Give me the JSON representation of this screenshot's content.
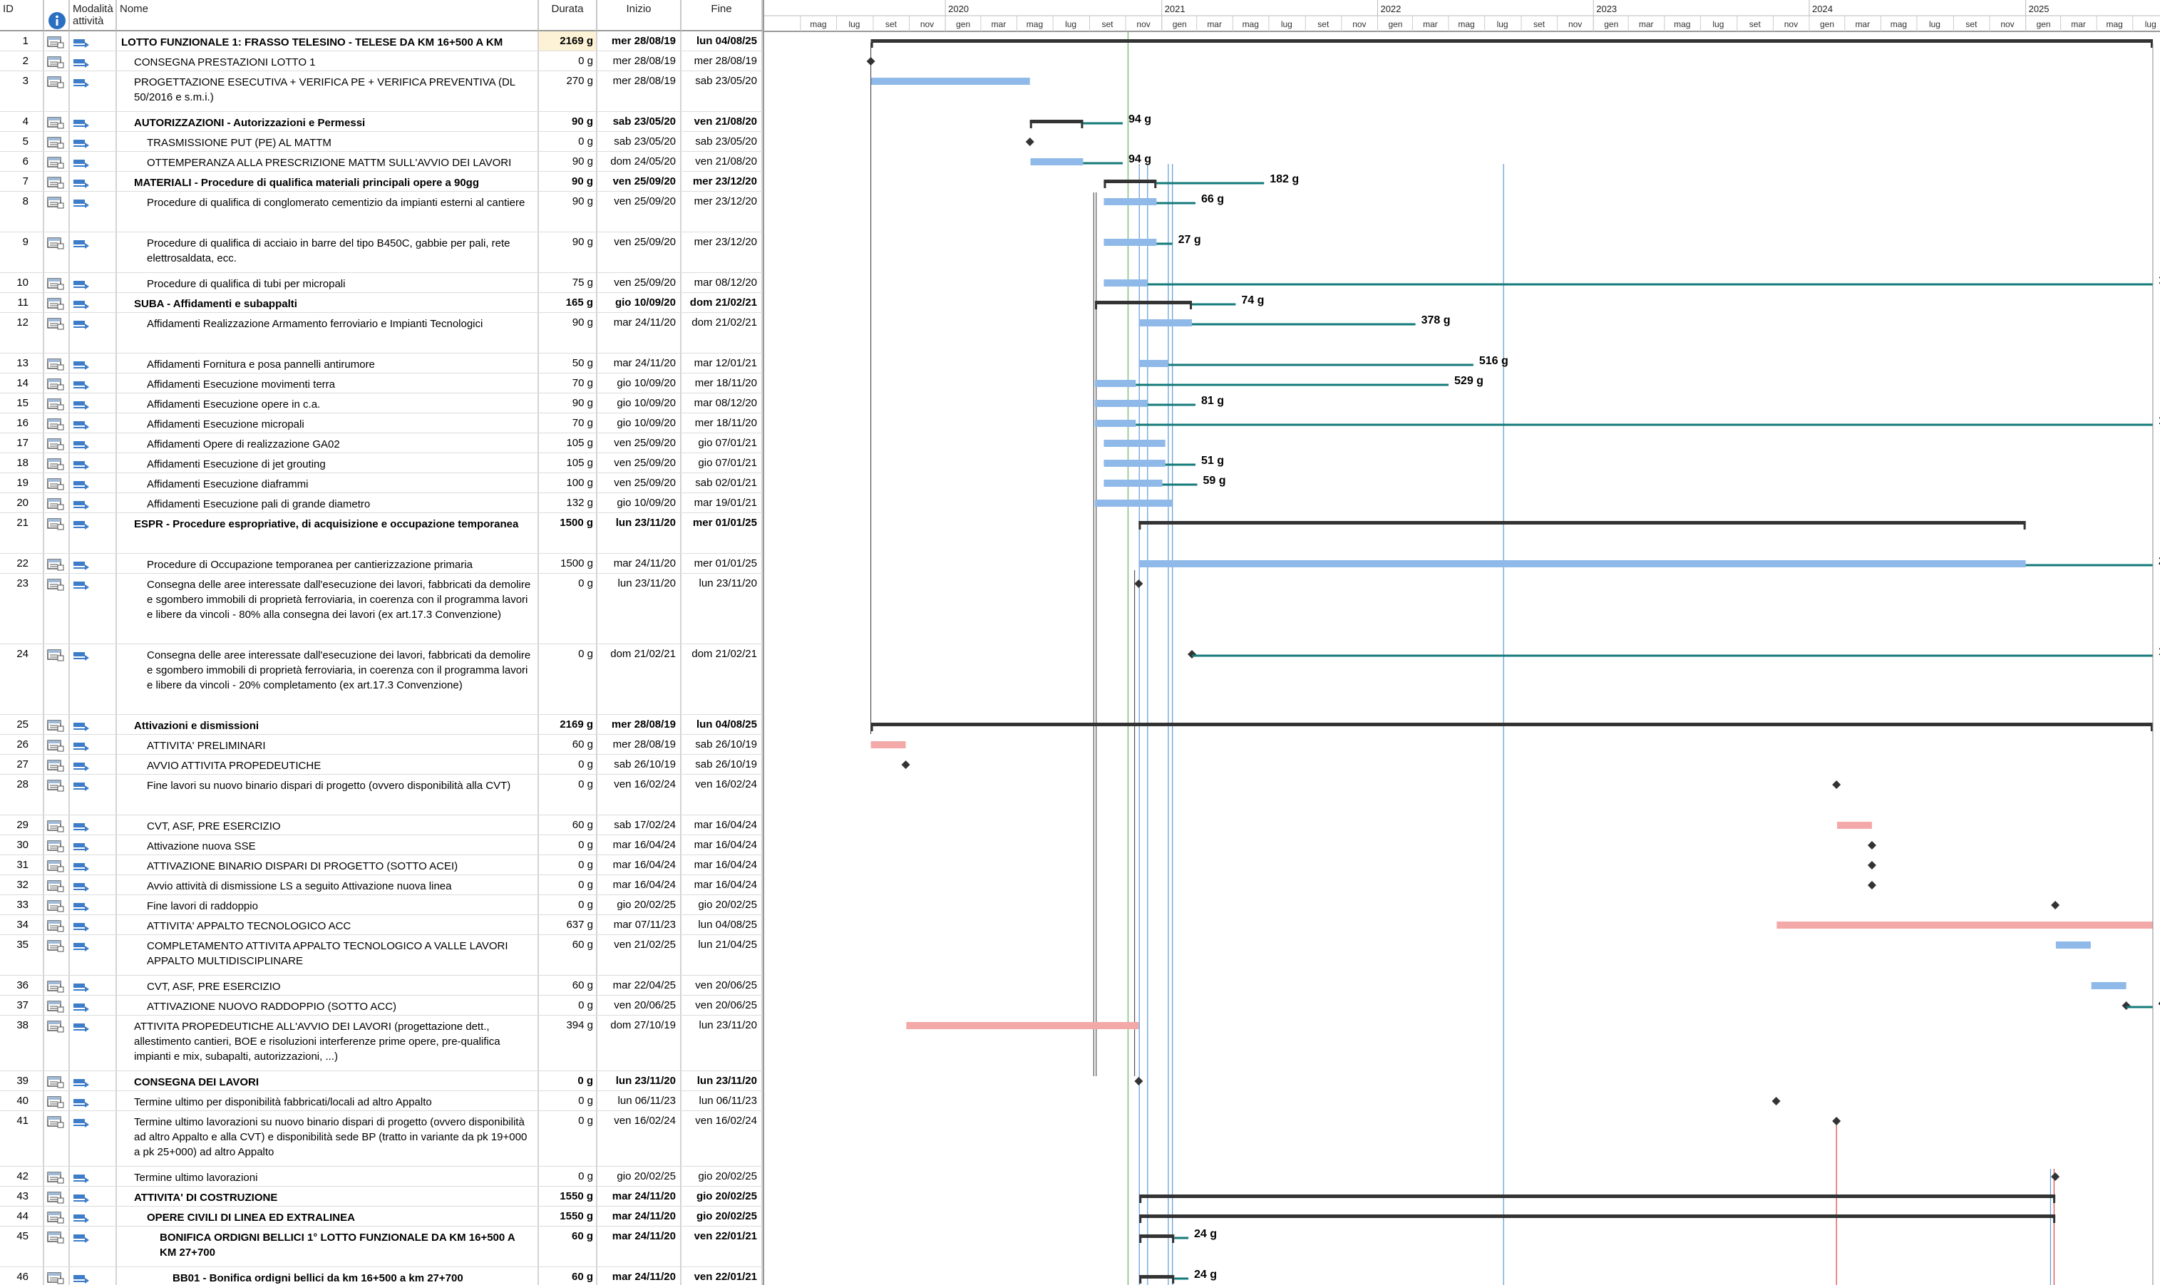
{
  "headers": {
    "id": "ID",
    "info_icon": "info-icon",
    "mode": "Modalità attività",
    "name": "Nome",
    "duration": "Durata",
    "start": "Inizio",
    "finish": "Fine"
  },
  "timescale": {
    "years": [
      {
        "label": "2020",
        "start": "2020-01-01"
      },
      {
        "label": "2021",
        "start": "2021-01-01"
      },
      {
        "label": "2022",
        "start": "2022-01-01"
      },
      {
        "label": "2023",
        "start": "2023-01-01"
      },
      {
        "label": "2024",
        "start": "2024-01-01"
      },
      {
        "label": "2025",
        "start": "2025-01-01"
      }
    ],
    "months": [
      {
        "label": "mag",
        "start": "2019-05-01"
      },
      {
        "label": "lug",
        "start": "2019-07-01"
      },
      {
        "label": "set",
        "start": "2019-09-01"
      },
      {
        "label": "nov",
        "start": "2019-11-01"
      },
      {
        "label": "gen",
        "start": "2020-01-01"
      },
      {
        "label": "mar",
        "start": "2020-03-01"
      },
      {
        "label": "mag",
        "start": "2020-05-01"
      },
      {
        "label": "lug",
        "start": "2020-07-01"
      },
      {
        "label": "set",
        "start": "2020-09-01"
      },
      {
        "label": "nov",
        "start": "2020-11-01"
      },
      {
        "label": "gen",
        "start": "2021-01-01"
      },
      {
        "label": "mar",
        "start": "2021-03-01"
      },
      {
        "label": "mag",
        "start": "2021-05-01"
      },
      {
        "label": "lug",
        "start": "2021-07-01"
      },
      {
        "label": "set",
        "start": "2021-09-01"
      },
      {
        "label": "nov",
        "start": "2021-11-01"
      },
      {
        "label": "gen",
        "start": "2022-01-01"
      },
      {
        "label": "mar",
        "start": "2022-03-01"
      },
      {
        "label": "mag",
        "start": "2022-05-01"
      },
      {
        "label": "lug",
        "start": "2022-07-01"
      },
      {
        "label": "set",
        "start": "2022-09-01"
      },
      {
        "label": "nov",
        "start": "2022-11-01"
      },
      {
        "label": "gen",
        "start": "2023-01-01"
      },
      {
        "label": "mar",
        "start": "2023-03-01"
      },
      {
        "label": "mag",
        "start": "2023-05-01"
      },
      {
        "label": "lug",
        "start": "2023-07-01"
      },
      {
        "label": "set",
        "start": "2023-09-01"
      },
      {
        "label": "nov",
        "start": "2023-11-01"
      },
      {
        "label": "gen",
        "start": "2024-01-01"
      },
      {
        "label": "mar",
        "start": "2024-03-01"
      },
      {
        "label": "mag",
        "start": "2024-05-01"
      },
      {
        "label": "lug",
        "start": "2024-07-01"
      },
      {
        "label": "set",
        "start": "2024-09-01"
      },
      {
        "label": "nov",
        "start": "2024-11-01"
      },
      {
        "label": "gen",
        "start": "2025-01-01"
      },
      {
        "label": "mar",
        "start": "2025-03-01"
      },
      {
        "label": "mag",
        "start": "2025-05-01"
      },
      {
        "label": "lug",
        "start": "2025-07-01"
      },
      {
        "label": "set",
        "start": "2025-09-01"
      }
    ]
  },
  "colors": {
    "task_bar": "#8fb9e8",
    "critical_bar": "#f4a9a9",
    "summary_bar": "#333333",
    "slack_line": "#137a7a",
    "link_line": "#555555",
    "link_blue": "#5b9bd5",
    "link_red": "#e0403c",
    "status_date_line": "#7fbf7f"
  },
  "tasks": [
    {
      "id": "1",
      "name": "LOTTO FUNZIONALE 1: FRASSO TELESINO - TELESE DA KM 16+500 A KM 27+700",
      "duration": "2169 g",
      "start": "mer 28/08/19",
      "finish": "lun 04/08/25",
      "bold": true,
      "indent": 0,
      "lines": 1,
      "type": "summary",
      "s": "2019-08-28",
      "f": "2025-08-04",
      "selected": true
    },
    {
      "id": "2",
      "name": "CONSEGNA PRESTAZIONI LOTTO 1",
      "duration": "0 g",
      "start": "mer 28/08/19",
      "finish": "mer 28/08/19",
      "indent": 1,
      "lines": 1,
      "type": "milestone",
      "s": "2019-08-28",
      "f": "2019-08-28"
    },
    {
      "id": "3",
      "name": "PROGETTAZIONE ESECUTIVA + VERIFICA PE + VERIFICA PREVENTIVA (DL 50/2016 e s.m.i.)",
      "duration": "270 g",
      "start": "mer 28/08/19",
      "finish": "sab 23/05/20",
      "indent": 1,
      "lines": 2,
      "type": "task",
      "s": "2019-08-28",
      "f": "2020-05-23"
    },
    {
      "id": "4",
      "name": "AUTORIZZAZIONI - Autorizzazioni e Permessi",
      "duration": "90 g",
      "start": "sab 23/05/20",
      "finish": "ven 21/08/20",
      "bold": true,
      "indent": 1,
      "lines": 1,
      "type": "summary",
      "s": "2020-05-23",
      "f": "2020-08-21",
      "slack_to": "2020-10-27",
      "slack_label": "94 g"
    },
    {
      "id": "5",
      "name": "TRASMISSIONE PUT (PE) AL MATTM",
      "duration": "0 g",
      "start": "sab 23/05/20",
      "finish": "sab 23/05/20",
      "indent": 2,
      "lines": 1,
      "type": "milestone",
      "s": "2020-05-23",
      "f": "2020-05-23"
    },
    {
      "id": "6",
      "name": "OTTEMPERANZA ALLA PRESCRIZIONE MATTM SULL'AVVIO DEI LAVORI",
      "duration": "90 g",
      "start": "dom 24/05/20",
      "finish": "ven 21/08/20",
      "indent": 2,
      "lines": 1,
      "type": "task",
      "s": "2020-05-24",
      "f": "2020-08-21",
      "slack_to": "2020-10-27",
      "slack_label": "94 g"
    },
    {
      "id": "7",
      "name": "MATERIALI - Procedure di qualifica materiali principali opere a 90gg",
      "duration": "90 g",
      "start": "ven 25/09/20",
      "finish": "mer 23/12/20",
      "bold": true,
      "indent": 1,
      "lines": 1,
      "type": "summary",
      "s": "2020-09-25",
      "f": "2020-12-23",
      "slack_to": "2021-06-23",
      "slack_label": "182 g"
    },
    {
      "id": "8",
      "name": "Procedure di qualifica di conglomerato cementizio da impianti esterni al cantiere",
      "duration": "90 g",
      "start": "ven 25/09/20",
      "finish": "mer 23/12/20",
      "indent": 2,
      "lines": 2,
      "type": "task",
      "s": "2020-09-25",
      "f": "2020-12-23",
      "slack_to": "2021-02-27",
      "slack_label": "66 g"
    },
    {
      "id": "9",
      "name": "Procedure di qualifica di acciaio in barre del tipo B450C, gabbie per pali, rete elettrosaldata, ecc.",
      "duration": "90 g",
      "start": "ven 25/09/20",
      "finish": "mer 23/12/20",
      "indent": 2,
      "lines": 2,
      "type": "task",
      "s": "2020-09-25",
      "f": "2020-12-23",
      "slack_to": "2021-01-19",
      "slack_label": "27 g"
    },
    {
      "id": "10",
      "name": "Procedure di qualifica di tubi per micropali",
      "duration": "75 g",
      "start": "ven 25/09/20",
      "finish": "mar 08/12/20",
      "indent": 2,
      "lines": 1,
      "type": "task",
      "s": "2020-09-25",
      "f": "2020-12-08",
      "slack_to": "2025-08-04",
      "slack_label": "1700 g"
    },
    {
      "id": "11",
      "name": "SUBA - Affidamenti e subappalti",
      "duration": "165 g",
      "start": "gio 10/09/20",
      "finish": "dom 21/02/21",
      "bold": true,
      "indent": 1,
      "lines": 1,
      "type": "summary",
      "s": "2020-09-10",
      "f": "2021-02-21",
      "slack_to": "2021-05-06",
      "slack_label": "74 g"
    },
    {
      "id": "12",
      "name": "Affidamenti Realizzazione Armamento ferroviario e Impianti Tecnologici",
      "duration": "90 g",
      "start": "mar 24/11/20",
      "finish": "dom 21/02/21",
      "indent": 2,
      "lines": 2,
      "type": "task",
      "s": "2020-11-24",
      "f": "2021-02-21",
      "slack_to": "2022-03-06",
      "slack_label": "378 g"
    },
    {
      "id": "13",
      "name": "Affidamenti Fornitura e posa pannelli antirumore",
      "duration": "50 g",
      "start": "mar 24/11/20",
      "finish": "mar 12/01/21",
      "indent": 2,
      "lines": 1,
      "type": "task",
      "s": "2020-11-24",
      "f": "2021-01-12",
      "slack_to": "2022-06-12",
      "slack_label": "516 g"
    },
    {
      "id": "14",
      "name": "Affidamenti Esecuzione movimenti terra",
      "duration": "70 g",
      "start": "gio 10/09/20",
      "finish": "mer 18/11/20",
      "indent": 2,
      "lines": 1,
      "type": "task",
      "s": "2020-09-10",
      "f": "2020-11-18",
      "slack_to": "2022-05-01",
      "slack_label": "529 g"
    },
    {
      "id": "15",
      "name": "Affidamenti Esecuzione opere in c.a.",
      "duration": "90 g",
      "start": "gio 10/09/20",
      "finish": "mar 08/12/20",
      "indent": 2,
      "lines": 1,
      "type": "task",
      "s": "2020-09-10",
      "f": "2020-12-08",
      "slack_to": "2021-02-27",
      "slack_label": "81 g"
    },
    {
      "id": "16",
      "name": "Affidamenti Esecuzione micropali",
      "duration": "70 g",
      "start": "gio 10/09/20",
      "finish": "mer 18/11/20",
      "indent": 2,
      "lines": 1,
      "type": "task",
      "s": "2020-09-10",
      "f": "2020-11-18",
      "slack_to": "2025-08-04",
      "slack_label": "1720 g"
    },
    {
      "id": "17",
      "name": "Affidamenti Opere di realizzazione GA02",
      "duration": "105 g",
      "start": "ven 25/09/20",
      "finish": "gio 07/01/21",
      "indent": 2,
      "lines": 1,
      "type": "task",
      "s": "2020-09-25",
      "f": "2021-01-07"
    },
    {
      "id": "18",
      "name": "Affidamenti Esecuzione di jet grouting",
      "duration": "105 g",
      "start": "ven 25/09/20",
      "finish": "gio 07/01/21",
      "indent": 2,
      "lines": 1,
      "type": "task",
      "s": "2020-09-25",
      "f": "2021-01-07",
      "slack_to": "2021-02-27",
      "slack_label": "51 g"
    },
    {
      "id": "19",
      "name": "Affidamenti Esecuzione diaframmi",
      "duration": "100 g",
      "start": "ven 25/09/20",
      "finish": "sab 02/01/21",
      "indent": 2,
      "lines": 1,
      "type": "task",
      "s": "2020-09-25",
      "f": "2021-01-02",
      "slack_to": "2021-03-02",
      "slack_label": "59 g"
    },
    {
      "id": "20",
      "name": "Affidamenti Esecuzione pali di grande diametro",
      "duration": "132 g",
      "start": "gio 10/09/20",
      "finish": "mar 19/01/21",
      "indent": 2,
      "lines": 1,
      "type": "task",
      "s": "2020-09-10",
      "f": "2021-01-19"
    },
    {
      "id": "21",
      "name": "ESPR - Procedure espropriative, di acquisizione e occupazione temporanea",
      "duration": "1500 g",
      "start": "lun 23/11/20",
      "finish": "mer 01/01/25",
      "bold": true,
      "indent": 1,
      "lines": 2,
      "type": "summary",
      "s": "2020-11-23",
      "f": "2025-01-01"
    },
    {
      "id": "22",
      "name": "Procedure di Occupazione temporanea per cantierizzazione primaria",
      "duration": "1500 g",
      "start": "mar 24/11/20",
      "finish": "mer 01/01/25",
      "indent": 2,
      "lines": 1,
      "type": "task",
      "s": "2020-11-24",
      "f": "2025-01-01",
      "slack_to": "2025-08-04",
      "slack_label": "215 g"
    },
    {
      "id": "23",
      "name": "Consegna delle aree interessate dall'esecuzione dei lavori, fabbricati da demolire e sgombero immobili di proprietà ferroviaria, in coerenza con il programma lavori e libere da vincoli - 80% alla consegna dei lavori (ex art.17.3 Convenzione)",
      "duration": "0 g",
      "start": "lun 23/11/20",
      "finish": "lun 23/11/20",
      "indent": 2,
      "lines": 4,
      "type": "milestone",
      "s": "2020-11-23",
      "f": "2020-11-23"
    },
    {
      "id": "24",
      "name": "Consegna delle aree interessate dall'esecuzione dei lavori, fabbricati da demolire e sgombero immobili di proprietà ferroviaria, in coerenza con il programma lavori e libere da vincoli - 20% completamento (ex art.17.3 Convenzione)",
      "duration": "0 g",
      "start": "dom 21/02/21",
      "finish": "dom 21/02/21",
      "indent": 2,
      "lines": 4,
      "type": "milestone",
      "s": "2021-02-21",
      "f": "2021-02-21",
      "slack_to": "2025-08-04",
      "slack_label": "1625 g"
    },
    {
      "id": "25",
      "name": "Attivazioni e dismissioni",
      "duration": "2169 g",
      "start": "mer 28/08/19",
      "finish": "lun 04/08/25",
      "bold": true,
      "indent": 1,
      "lines": 1,
      "type": "summary",
      "s": "2019-08-28",
      "f": "2025-08-04"
    },
    {
      "id": "26",
      "name": "ATTIVITA' PRELIMINARI",
      "duration": "60 g",
      "start": "mer 28/08/19",
      "finish": "sab 26/10/19",
      "indent": 2,
      "lines": 1,
      "type": "critical",
      "s": "2019-08-28",
      "f": "2019-10-26"
    },
    {
      "id": "27",
      "name": "AVVIO ATTIVITA PROPEDEUTICHE",
      "duration": "0 g",
      "start": "sab 26/10/19",
      "finish": "sab 26/10/19",
      "indent": 2,
      "lines": 1,
      "type": "milestone",
      "s": "2019-10-26",
      "f": "2019-10-26"
    },
    {
      "id": "28",
      "name": "Fine lavori su nuovo binario dispari di progetto (ovvero disponibilità alla CVT)",
      "duration": "0 g",
      "start": "ven 16/02/24",
      "finish": "ven 16/02/24",
      "indent": 2,
      "lines": 2,
      "type": "milestone",
      "s": "2024-02-16",
      "f": "2024-02-16"
    },
    {
      "id": "29",
      "name": "CVT, ASF, PRE ESERCIZIO",
      "duration": "60 g",
      "start": "sab 17/02/24",
      "finish": "mar 16/04/24",
      "indent": 2,
      "lines": 1,
      "type": "critical",
      "s": "2024-02-17",
      "f": "2024-04-16"
    },
    {
      "id": "30",
      "name": "Attivazione nuova SSE",
      "duration": "0 g",
      "start": "mar 16/04/24",
      "finish": "mar 16/04/24",
      "indent": 2,
      "lines": 1,
      "type": "milestone",
      "s": "2024-04-16",
      "f": "2024-04-16"
    },
    {
      "id": "31",
      "name": "ATTIVAZIONE BINARIO DISPARI DI PROGETTO (SOTTO ACEI)",
      "duration": "0 g",
      "start": "mar 16/04/24",
      "finish": "mar 16/04/24",
      "indent": 2,
      "lines": 1,
      "type": "milestone",
      "s": "2024-04-16",
      "f": "2024-04-16"
    },
    {
      "id": "32",
      "name": "Avvio attività di dismissione LS a seguito Attivazione nuova linea",
      "duration": "0 g",
      "start": "mar 16/04/24",
      "finish": "mar 16/04/24",
      "indent": 2,
      "lines": 1,
      "type": "milestone",
      "s": "2024-04-16",
      "f": "2024-04-16"
    },
    {
      "id": "33",
      "name": "Fine lavori di raddoppio",
      "duration": "0 g",
      "start": "gio 20/02/25",
      "finish": "gio 20/02/25",
      "indent": 2,
      "lines": 1,
      "type": "milestone",
      "s": "2025-02-20",
      "f": "2025-02-20"
    },
    {
      "id": "34",
      "name": "ATTIVITA' APPALTO TECNOLOGICO ACC",
      "duration": "637 g",
      "start": "mar 07/11/23",
      "finish": "lun 04/08/25",
      "indent": 2,
      "lines": 1,
      "type": "critical",
      "s": "2023-11-07",
      "f": "2025-08-04"
    },
    {
      "id": "35",
      "name": "COMPLETAMENTO ATTIVITA APPALTO TECNOLOGICO A VALLE LAVORI APPALTO MULTIDISCIPLINARE",
      "duration": "60 g",
      "start": "ven 21/02/25",
      "finish": "lun 21/04/25",
      "indent": 2,
      "lines": 2,
      "type": "task",
      "s": "2025-02-21",
      "f": "2025-04-21"
    },
    {
      "id": "36",
      "name": "CVT, ASF, PRE ESERCIZIO",
      "duration": "60 g",
      "start": "mar 22/04/25",
      "finish": "ven 20/06/25",
      "indent": 2,
      "lines": 1,
      "type": "task",
      "s": "2025-04-22",
      "f": "2025-06-20"
    },
    {
      "id": "37",
      "name": "ATTIVAZIONE NUOVO RADDOPPIO (SOTTO ACC)",
      "duration": "0 g",
      "start": "ven 20/06/25",
      "finish": "ven 20/06/25",
      "indent": 2,
      "lines": 1,
      "type": "milestone",
      "s": "2025-06-20",
      "f": "2025-06-20",
      "slack_to": "2025-08-04",
      "slack_label": "45 g"
    },
    {
      "id": "38",
      "name": "ATTIVITA PROPEDEUTICHE ALL'AVVIO DEI LAVORI (progettazione dett., allestimento cantieri, BOE e risoluzioni interferenze prime opere, pre-qualifica impianti e mix, subapalti, autorizzazioni, ...)",
      "duration": "394 g",
      "start": "dom 27/10/19",
      "finish": "lun 23/11/20",
      "indent": 1,
      "lines": 3,
      "type": "critical",
      "s": "2019-10-27",
      "f": "2020-11-23"
    },
    {
      "id": "39",
      "name": "CONSEGNA DEI LAVORI",
      "duration": "0 g",
      "start": "lun 23/11/20",
      "finish": "lun 23/11/20",
      "bold": true,
      "indent": 1,
      "lines": 1,
      "type": "milestone",
      "s": "2020-11-23",
      "f": "2020-11-23"
    },
    {
      "id": "40",
      "name": "Termine ultimo per disponibilità fabbricati/locali ad altro Appalto",
      "duration": "0 g",
      "start": "lun 06/11/23",
      "finish": "lun 06/11/23",
      "indent": 1,
      "lines": 1,
      "type": "milestone",
      "s": "2023-11-06",
      "f": "2023-11-06"
    },
    {
      "id": "41",
      "name": "Termine ultimo lavorazioni su nuovo binario dispari di progetto (ovvero disponibilità ad altro Appalto e alla CVT) e disponibilità sede BP (tratto in variante da pk 19+000 a pk 25+000) ad altro Appalto",
      "duration": "0 g",
      "start": "ven 16/02/24",
      "finish": "ven 16/02/24",
      "indent": 1,
      "lines": 3,
      "type": "milestone",
      "s": "2024-02-16",
      "f": "2024-02-16"
    },
    {
      "id": "42",
      "name": "Termine ultimo lavorazioni",
      "duration": "0 g",
      "start": "gio 20/02/25",
      "finish": "gio 20/02/25",
      "indent": 1,
      "lines": 1,
      "type": "milestone",
      "s": "2025-02-20",
      "f": "2025-02-20"
    },
    {
      "id": "43",
      "name": "ATTIVITA' DI COSTRUZIONE",
      "duration": "1550 g",
      "start": "mar 24/11/20",
      "finish": "gio 20/02/25",
      "bold": true,
      "indent": 1,
      "lines": 1,
      "type": "summary",
      "s": "2020-11-24",
      "f": "2025-02-20"
    },
    {
      "id": "44",
      "name": "OPERE CIVILI DI LINEA ED EXTRALINEA",
      "duration": "1550 g",
      "start": "mar 24/11/20",
      "finish": "gio 20/02/25",
      "bold": true,
      "indent": 2,
      "lines": 1,
      "type": "summary",
      "s": "2020-11-24",
      "f": "2025-02-20"
    },
    {
      "id": "45",
      "name": "BONIFICA ORDIGNI BELLICI 1° LOTTO FUNZIONALE DA KM 16+500 A KM 27+700",
      "duration": "60 g",
      "start": "mar 24/11/20",
      "finish": "ven 22/01/21",
      "bold": true,
      "indent": 3,
      "lines": 2,
      "type": "summary",
      "s": "2020-11-24",
      "f": "2021-01-22",
      "slack_to": "2021-02-15",
      "slack_label": "24 g"
    },
    {
      "id": "46",
      "name": "BB01 - Bonifica ordigni bellici da km 16+500 a km 27+700",
      "duration": "60 g",
      "start": "mar 24/11/20",
      "finish": "ven 22/01/21",
      "bold": true,
      "indent": 4,
      "lines": 1,
      "type": "summary",
      "s": "2020-11-24",
      "f": "2021-01-22",
      "slack_to": "2021-02-15",
      "slack_label": "24 g"
    }
  ]
}
